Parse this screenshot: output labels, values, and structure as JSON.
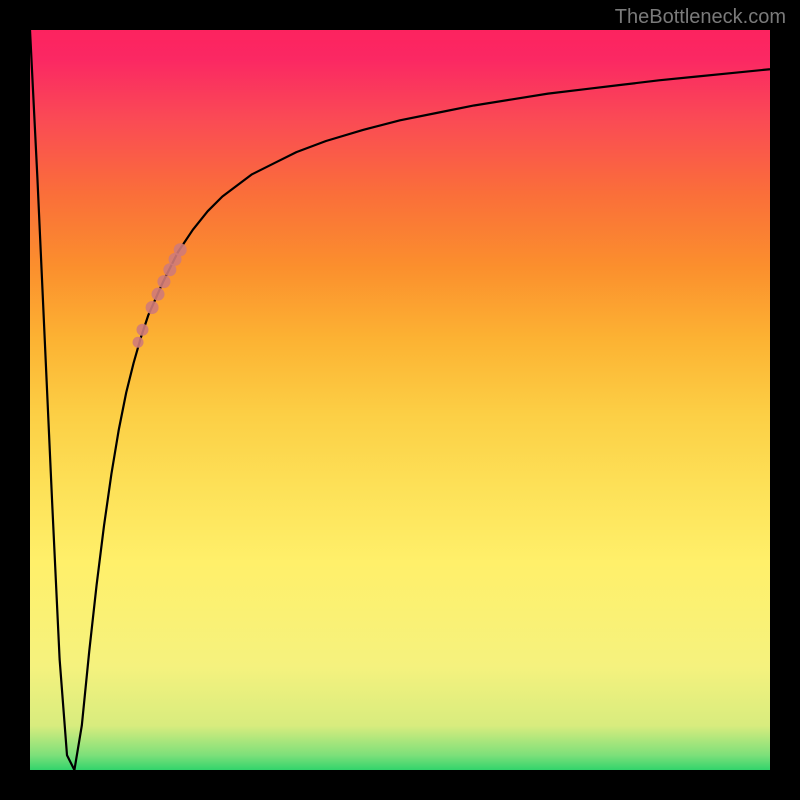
{
  "watermark": "TheBottleneck.com",
  "colors": {
    "curve": "#000000",
    "marker": "#cf7b79",
    "marker_alt": "#d98e87",
    "frame": "#000000"
  },
  "chart_data": {
    "type": "line",
    "title": "",
    "xlabel": "",
    "ylabel": "",
    "xlim": [
      0,
      100
    ],
    "ylim": [
      0,
      100
    ],
    "grid": false,
    "legend": false,
    "x": [
      0,
      1,
      2,
      3,
      4,
      5,
      6,
      7,
      8,
      9,
      10,
      11,
      12,
      13,
      14,
      15,
      16,
      18,
      20,
      22,
      24,
      26,
      28,
      30,
      33,
      36,
      40,
      45,
      50,
      55,
      60,
      65,
      70,
      75,
      80,
      85,
      90,
      95,
      100
    ],
    "y": [
      100,
      80,
      58,
      36,
      15,
      2,
      0,
      6,
      16,
      25,
      33,
      40,
      46,
      51,
      55,
      58.5,
      61.5,
      66,
      70,
      73,
      75.5,
      77.5,
      79,
      80.5,
      82,
      83.5,
      85,
      86.5,
      87.8,
      88.8,
      89.8,
      90.6,
      91.4,
      92,
      92.6,
      93.2,
      93.7,
      94.2,
      94.7
    ],
    "overlay_markers": {
      "color": "#cf7b79",
      "points": [
        {
          "x": 16.5,
          "y": 62.5,
          "r": 6.5
        },
        {
          "x": 17.3,
          "y": 64.3,
          "r": 6.5
        },
        {
          "x": 18.1,
          "y": 66.0,
          "r": 6.5
        },
        {
          "x": 18.9,
          "y": 67.6,
          "r": 6.5
        },
        {
          "x": 19.6,
          "y": 69.0,
          "r": 6.5
        },
        {
          "x": 20.3,
          "y": 70.3,
          "r": 6.5
        },
        {
          "x": 15.2,
          "y": 59.5,
          "r": 6.0
        },
        {
          "x": 14.6,
          "y": 57.8,
          "r": 5.5
        }
      ]
    }
  }
}
